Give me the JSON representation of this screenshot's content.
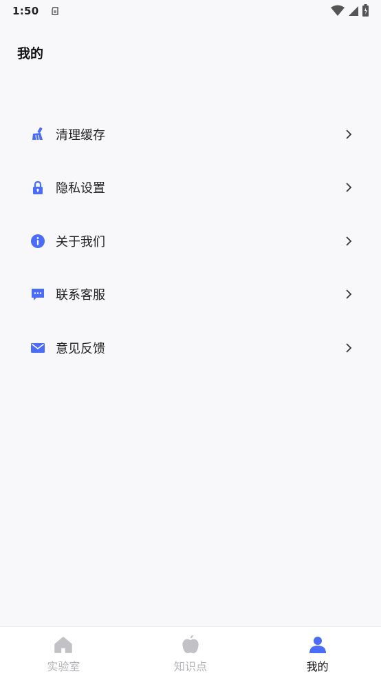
{
  "status_bar": {
    "time": "1:50"
  },
  "header": {
    "title": "我的"
  },
  "menu": {
    "items": [
      {
        "label": "清理缓存",
        "icon": "broom-icon"
      },
      {
        "label": "隐私设置",
        "icon": "lock-icon"
      },
      {
        "label": "关于我们",
        "icon": "info-icon"
      },
      {
        "label": "联系客服",
        "icon": "chat-icon"
      },
      {
        "label": "意见反馈",
        "icon": "mail-icon"
      }
    ]
  },
  "tab_bar": {
    "tabs": [
      {
        "label": "实验室",
        "icon": "home-icon",
        "active": false
      },
      {
        "label": "知识点",
        "icon": "apple-icon",
        "active": false
      },
      {
        "label": "我的",
        "icon": "user-icon",
        "active": true
      }
    ]
  },
  "colors": {
    "accent": "#4a6cf7",
    "inactive": "#c2c2c6",
    "background": "#f8f8fa"
  }
}
